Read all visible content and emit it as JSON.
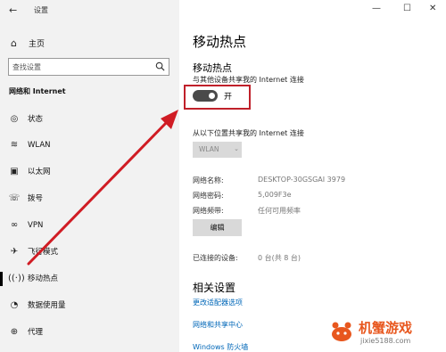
{
  "window": {
    "app_title": "设置",
    "back_glyph": "←",
    "minimize_glyph": "—",
    "maximize_glyph": "☐",
    "close_glyph": "✕"
  },
  "sidebar": {
    "home_label": "主页",
    "search_placeholder": "查找设置",
    "section_title": "网络和 Internet",
    "items": [
      {
        "label": "状态",
        "icon": "globe-icon"
      },
      {
        "label": "WLAN",
        "icon": "wifi-icon"
      },
      {
        "label": "以太网",
        "icon": "ethernet-icon"
      },
      {
        "label": "拨号",
        "icon": "dialup-icon"
      },
      {
        "label": "VPN",
        "icon": "vpn-icon"
      },
      {
        "label": "飞行模式",
        "icon": "airplane-icon"
      },
      {
        "label": "移动热点",
        "icon": "hotspot-icon",
        "active": true
      },
      {
        "label": "数据使用量",
        "icon": "data-usage-icon"
      },
      {
        "label": "代理",
        "icon": "proxy-icon"
      }
    ]
  },
  "main": {
    "page_title": "移动热点",
    "section_title": "移动热点",
    "share_label": "与其他设备共享我的 Internet 连接",
    "toggle_state": "开",
    "toggle_on": true,
    "share_from_label": "从以下位置共享我的 Internet 连接",
    "share_from_value": "WLAN",
    "network_name_label": "网络名称:",
    "network_name_value": "DESKTOP-30GSGAI 3979",
    "network_password_label": "网络密码:",
    "network_password_value": "5,009F3e",
    "network_band_label": "网络频带:",
    "network_band_value": "任何可用频率",
    "edit_button": "编辑",
    "connected_label": "已连接的设备:",
    "connected_value": "0 台(共 8 台)",
    "related_title": "相关设置",
    "links": [
      "更改适配器选项",
      "网络和共享中心",
      "Windows 防火墙"
    ]
  },
  "watermark": {
    "text": "机蟹游戏",
    "url": "jixie5188.com"
  },
  "colors": {
    "highlight": "#c0202a",
    "arrow": "#d01c24",
    "link": "#0067b8",
    "toggle": "#4a4a4a",
    "watermark": "#e8571e"
  }
}
